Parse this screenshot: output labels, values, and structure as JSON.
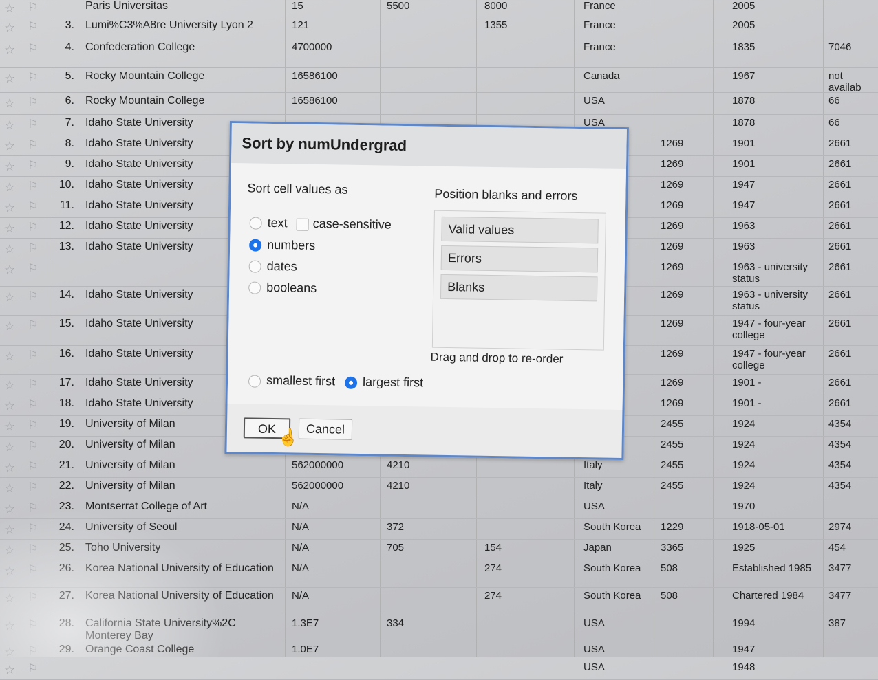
{
  "spreadsheet": {
    "rows": [
      {
        "num": "",
        "name": "Paris Universitas",
        "c1": "15",
        "c2": "5500",
        "c3": "8000",
        "country": "France",
        "c5": "",
        "year": "2005",
        "c7": ""
      },
      {
        "num": "3.",
        "name": "Lumi%C3%A8re University Lyon 2",
        "c1": "121",
        "c2": "",
        "c3": "1355",
        "country": "France",
        "c5": "",
        "year": "2005",
        "c7": ""
      },
      {
        "num": "4.",
        "name": "Confederation College",
        "c1": "4700000",
        "c2": "",
        "c3": "",
        "country": "France",
        "c5": "",
        "year": "1835",
        "c7": "7046"
      },
      {
        "num": "5.",
        "name": "Rocky Mountain College",
        "c1": "16586100",
        "c2": "",
        "c3": "",
        "country": "Canada",
        "c5": "",
        "year": "1967",
        "c7": "not availab"
      },
      {
        "num": "6.",
        "name": "Rocky Mountain College",
        "c1": "16586100",
        "c2": "",
        "c3": "",
        "country": "USA",
        "c5": "",
        "year": "1878",
        "c7": "66"
      },
      {
        "num": "7.",
        "name": "Idaho State University",
        "c1": "",
        "c2": "",
        "c3": "",
        "country": "USA",
        "c5": "",
        "year": "1878",
        "c7": "66"
      },
      {
        "num": "8.",
        "name": "Idaho State University",
        "c1": "",
        "c2": "",
        "c3": "",
        "country": "",
        "c5": "1269",
        "year": "1901",
        "c7": "2661"
      },
      {
        "num": "9.",
        "name": "Idaho State University",
        "c1": "",
        "c2": "",
        "c3": "",
        "country": "",
        "c5": "1269",
        "year": "1901",
        "c7": "2661"
      },
      {
        "num": "10.",
        "name": "Idaho State University",
        "c1": "",
        "c2": "",
        "c3": "",
        "country": "",
        "c5": "1269",
        "year": "1947",
        "c7": "2661"
      },
      {
        "num": "11.",
        "name": "Idaho State University",
        "c1": "",
        "c2": "",
        "c3": "",
        "country": "",
        "c5": "1269",
        "year": "1947",
        "c7": "2661"
      },
      {
        "num": "12.",
        "name": "Idaho State University",
        "c1": "",
        "c2": "",
        "c3": "",
        "country": "",
        "c5": "1269",
        "year": "1963",
        "c7": "2661"
      },
      {
        "num": "13.",
        "name": "Idaho State University",
        "c1": "",
        "c2": "",
        "c3": "",
        "country": "",
        "c5": "1269",
        "year": "1963",
        "c7": "2661"
      },
      {
        "num": "",
        "name": "",
        "c1": "",
        "c2": "",
        "c3": "",
        "country": "",
        "c5": "1269",
        "year": "1963 - university status",
        "c7": "2661"
      },
      {
        "num": "14.",
        "name": "Idaho State University",
        "c1": "",
        "c2": "",
        "c3": "",
        "country": "",
        "c5": "1269",
        "year": "1963 - university status",
        "c7": "2661"
      },
      {
        "num": "15.",
        "name": "Idaho State University",
        "c1": "",
        "c2": "",
        "c3": "",
        "country": "",
        "c5": "1269",
        "year": "1947 - four-year college",
        "c7": "2661"
      },
      {
        "num": "16.",
        "name": "Idaho State University",
        "c1": "",
        "c2": "",
        "c3": "",
        "country": "",
        "c5": "1269",
        "year": "1947 - four-year college",
        "c7": "2661"
      },
      {
        "num": "17.",
        "name": "Idaho State University",
        "c1": "",
        "c2": "",
        "c3": "",
        "country": "",
        "c5": "1269",
        "year": "1901 -",
        "c7": "2661"
      },
      {
        "num": "18.",
        "name": "Idaho State University",
        "c1": "",
        "c2": "",
        "c3": "",
        "country": "",
        "c5": "1269",
        "year": "1901 -",
        "c7": "2661"
      },
      {
        "num": "19.",
        "name": "University of Milan",
        "c1": "",
        "c2": "",
        "c3": "",
        "country": "",
        "c5": "2455",
        "year": "1924",
        "c7": "4354"
      },
      {
        "num": "20.",
        "name": "University of Milan",
        "c1": "",
        "c2": "",
        "c3": "",
        "country": "",
        "c5": "2455",
        "year": "1924",
        "c7": "4354"
      },
      {
        "num": "21.",
        "name": "University of Milan",
        "c1": "562000000",
        "c2": "4210",
        "c3": "",
        "country": "Italy",
        "c5": "2455",
        "year": "1924",
        "c7": "4354"
      },
      {
        "num": "22.",
        "name": "University of Milan",
        "c1": "562000000",
        "c2": "4210",
        "c3": "",
        "country": "Italy",
        "c5": "2455",
        "year": "1924",
        "c7": "4354"
      },
      {
        "num": "23.",
        "name": "Montserrat College of Art",
        "c1": "N/A",
        "c2": "",
        "c3": "",
        "country": "USA",
        "c5": "",
        "year": "1970",
        "c7": ""
      },
      {
        "num": "24.",
        "name": "University of Seoul",
        "c1": "N/A",
        "c2": "372",
        "c3": "",
        "country": "South Korea",
        "c5": "1229",
        "year": "1918-05-01",
        "c7": "2974"
      },
      {
        "num": "25.",
        "name": "Toho University",
        "c1": "N/A",
        "c2": "705",
        "c3": "154",
        "country": "Japan",
        "c5": "3365",
        "year": "1925",
        "c7": "454"
      },
      {
        "num": "26.",
        "name": "Korea National University of Education",
        "c1": "N/A",
        "c2": "",
        "c3": "274",
        "country": "South Korea",
        "c5": "508",
        "year": "Established 1985",
        "c7": "3477"
      },
      {
        "num": "27.",
        "name": "Korea National University of Education",
        "c1": "N/A",
        "c2": "",
        "c3": "274",
        "country": "South Korea",
        "c5": "508",
        "year": "Chartered 1984",
        "c7": "3477"
      },
      {
        "num": "28.",
        "name": "California State University%2C Monterey Bay",
        "c1": "1.3E7",
        "c2": "334",
        "c3": "",
        "country": "USA",
        "c5": "",
        "year": "1994",
        "c7": "387"
      },
      {
        "num": "29.",
        "name": "Orange Coast College",
        "c1": "1.0E7",
        "c2": "",
        "c3": "",
        "country": "USA",
        "c5": "",
        "year": "1947",
        "c7": ""
      },
      {
        "num": "",
        "name": "",
        "c1": "",
        "c2": "",
        "c3": "",
        "country": "USA",
        "c5": "",
        "year": "1948",
        "c7": ""
      }
    ]
  },
  "dialog": {
    "title": "Sort by numUndergrad",
    "sort_as_label": "Sort cell values as",
    "opt_text": "text",
    "opt_case": "case-sensitive",
    "opt_numbers": "numbers",
    "opt_dates": "dates",
    "opt_booleans": "booleans",
    "selected_type": "numbers",
    "position_label": "Position blanks and errors",
    "order_items": [
      "Valid values",
      "Errors",
      "Blanks"
    ],
    "drag_hint": "Drag and drop to re-order",
    "opt_smallest": "smallest first",
    "opt_largest": "largest first",
    "selected_order": "largest first",
    "ok_label": "OK",
    "cancel_label": "Cancel"
  }
}
